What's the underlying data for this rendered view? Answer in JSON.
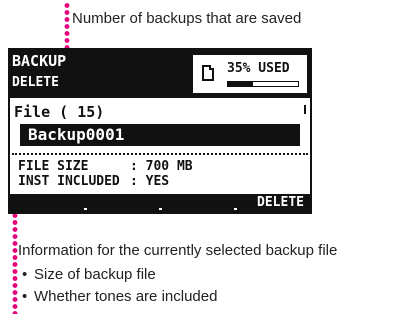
{
  "annotations": {
    "top_callout": "Number of backups that are saved",
    "bottom_callout": "Information for the currently selected backup file",
    "bullets": [
      "Size of backup file",
      "Whether tones are included"
    ],
    "accent_color": "#e6007e"
  },
  "screen": {
    "title": "BACKUP",
    "subtitle": "DELETE",
    "usage_label": "35% USED",
    "usage_fraction": 0.35,
    "file_count_label": "File ( 15)",
    "selected_file": "Backup0001",
    "file_size_label": "FILE SIZE",
    "file_size_value": ": 700 MB",
    "inst_label": "INST INCLUDED",
    "inst_value": ": YES",
    "delete_button": "DELETE"
  }
}
